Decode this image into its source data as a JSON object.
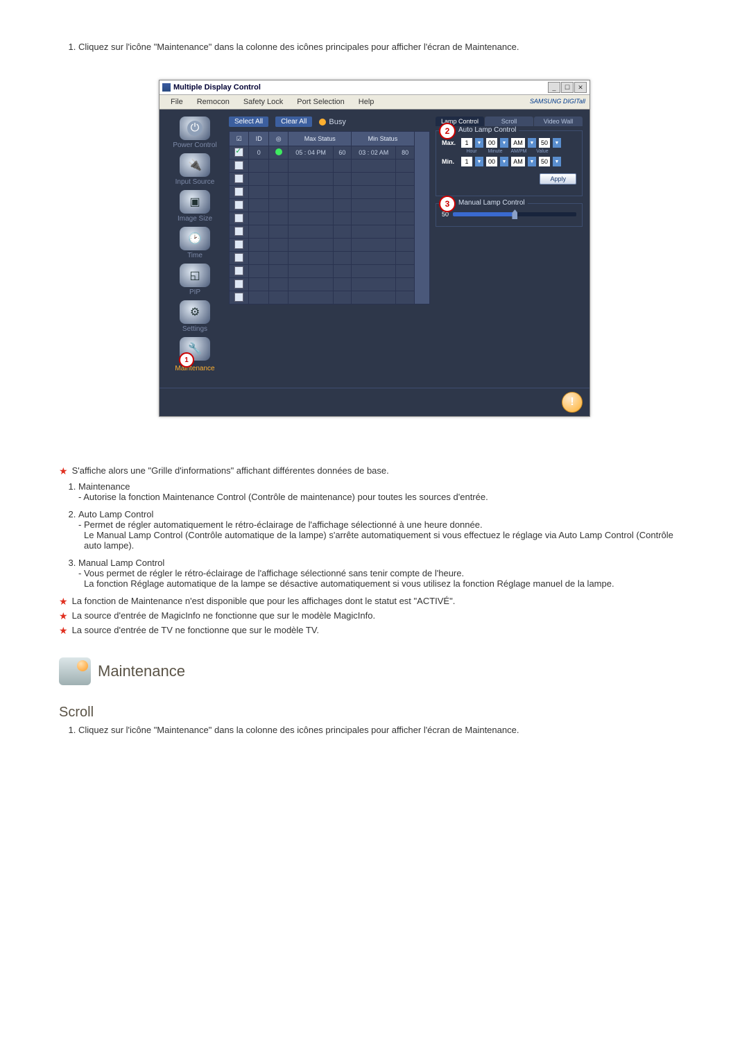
{
  "intro_1": "Cliquez sur l'icône \"Maintenance\" dans la colonne des icônes principales pour afficher l'écran de Maintenance.",
  "win": {
    "title": "Multiple Display Control",
    "menu": {
      "file": "File",
      "remocon": "Remocon",
      "safety": "Safety Lock",
      "port": "Port Selection",
      "help": "Help"
    },
    "brand": "SAMSUNG DIGITall",
    "buttons": {
      "select_all": "Select All",
      "clear_all": "Clear All",
      "busy": "Busy"
    },
    "side": {
      "power": "Power Control",
      "input": "Input Source",
      "image": "Image Size",
      "time": "Time",
      "pip": "PIP",
      "settings": "Settings",
      "maintenance": "Maintenance"
    },
    "grid": {
      "h_chk": "☑",
      "h_id": "ID",
      "h_led": "◎",
      "h_max": "Max Status",
      "h_min": "Min Status",
      "row0": {
        "id": "0",
        "max_t": "05 : 04 PM",
        "max_v": "60",
        "min_t": "03 : 02 AM",
        "min_v": "80"
      }
    },
    "tabs": {
      "lamp": "Lamp Control",
      "scroll": "Scroll",
      "video": "Video Wall"
    },
    "auto": {
      "title": "Auto Lamp Control",
      "max": "Max.",
      "min": "Min.",
      "hour": "1",
      "minute": "00",
      "ampm": "AM",
      "value": "50",
      "lbl_hour": "Hour",
      "lbl_min": "Minute",
      "lbl_ampm": "AM/PM",
      "lbl_val": "Value",
      "apply": "Apply"
    },
    "manual": {
      "title": "Manual Lamp Control",
      "value": "50"
    },
    "badges": {
      "b1": "1",
      "b2": "2",
      "b3": "3"
    }
  },
  "notes": {
    "star1": "S'affiche alors une \"Grille d'informations\" affichant différentes données de base.",
    "n1_t": "Maintenance",
    "n1_d": "- Autorise la fonction Maintenance Control (Contrôle de maintenance) pour toutes les sources d'entrée.",
    "n2_t": "Auto Lamp Control",
    "n2_d1": "- Permet de régler automatiquement le rétro-éclairage de l'affichage sélectionné à une heure donnée.",
    "n2_d2": "Le Manual Lamp Control (Contrôle automatique de la lampe) s'arrête automatiquement si vous effectuez le réglage via Auto Lamp Control (Contrôle auto lampe).",
    "n3_t": "Manual Lamp Control",
    "n3_d1": "- Vous permet de régler le rétro-éclairage de l'affichage sélectionné sans tenir compte de l'heure.",
    "n3_d2": "La fonction Réglage automatique de la lampe se désactive automatiquement si vous utilisez la fonction Réglage manuel de la lampe.",
    "star2": "La fonction de Maintenance n'est disponible que pour les affichages dont le statut est \"ACTIVÉ\".",
    "star3": "La source d'entrée de MagicInfo ne fonctionne que sur le modèle MagicInfo.",
    "star4": "La source d'entrée de TV ne fonctionne que sur le modèle TV."
  },
  "section": {
    "title": "Maintenance",
    "sub": "Scroll"
  },
  "intro_2": "Cliquez sur l'icône \"Maintenance\" dans la colonne des icônes principales pour afficher l'écran de Maintenance."
}
